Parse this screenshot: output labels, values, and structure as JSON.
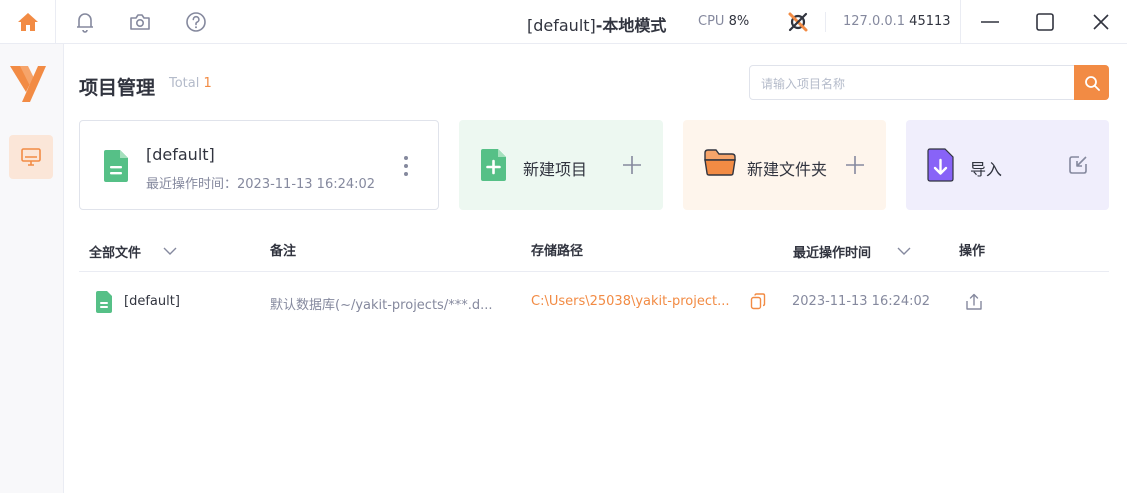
{
  "window": {
    "title_prefix": "[default]",
    "title_suffix": "-本地模式",
    "cpu_label": "CPU",
    "cpu_value": "8%",
    "host": "127.0.0.1",
    "port": "45113"
  },
  "page": {
    "title": "项目管理",
    "total_label": "Total",
    "total_count": "1",
    "search_placeholder": "请输入项目名称"
  },
  "current_project": {
    "name": "[default]",
    "last_op": "最近操作时间：2023-11-13 16:24:02"
  },
  "actions": {
    "new_project": "新建项目",
    "new_folder": "新建文件夹",
    "import": "导入"
  },
  "table": {
    "columns": [
      "全部文件",
      "备注",
      "存储路径",
      "最近操作时间",
      "操作"
    ],
    "rows": [
      {
        "name": "[default]",
        "note": "默认数据库(~/yakit-projects/***.d...",
        "path": "C:\\Users\\25038\\yakit-project...",
        "time": "2023-11-13 16:24:02"
      }
    ]
  },
  "colors": {
    "accent": "#f28b44",
    "green": "#56c087",
    "purple": "#8863f7"
  }
}
